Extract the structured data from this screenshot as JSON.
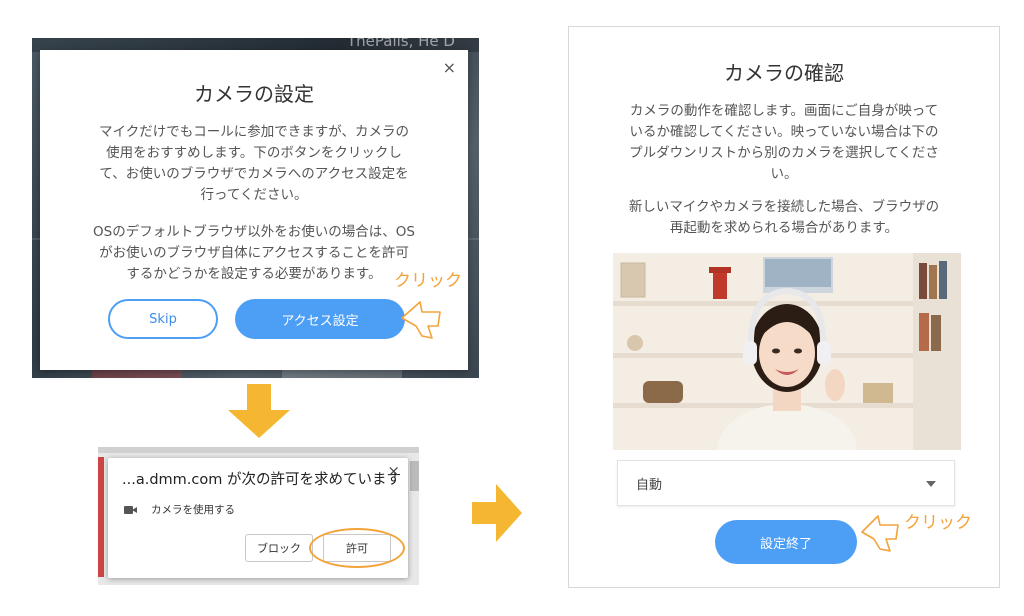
{
  "step1": {
    "title": "カメラの設定",
    "para1": [
      "マイクだけでもコールに参加できますが、カメラの",
      "使用をおすすめします。下のボタンをクリックし",
      "て、お使いのブラウザでカメラへのアクセス設定を",
      "行ってください。"
    ],
    "para2": [
      "OSのデフォルトブラウザ以外をお使いの場合は、OS",
      "がお使いのブラウザ自体にアクセスすることを許可",
      "するかどうかを設定する必要があります。"
    ],
    "skip_label": "Skip",
    "access_label": "アクセス設定",
    "close_glyph": "×",
    "background_text": "ThePalis, He D",
    "click_note": "クリック"
  },
  "step2": {
    "title": "...a.dmm.com が次の許可を求めています",
    "permission_label": "カメラを使用する",
    "block_label": "ブロック",
    "allow_label": "許可",
    "close_glyph": "×"
  },
  "step3": {
    "title": "カメラの確認",
    "para1": [
      "カメラの動作を確認します。画面にご自身が映って",
      "いるか確認してください。映っていない場合は下の",
      "プルダウンリストから別のカメラを選択してくださ",
      "い。"
    ],
    "para2": [
      "新しいマイクやカメラを接続した場合、ブラウザの",
      "再起動を求められる場合があります。"
    ],
    "select_value": "自動",
    "finish_label": "設定終了",
    "click_note": "クリック"
  },
  "colors": {
    "primary_blue": "#4d9ef5",
    "annotation_orange": "#f2a33a",
    "arrow_yellow": "#f5b731"
  },
  "icons": [
    "close-icon",
    "camera-icon",
    "chevron-down-icon",
    "pointer-hand-icon",
    "arrow-down-icon",
    "arrow-right-icon"
  ]
}
